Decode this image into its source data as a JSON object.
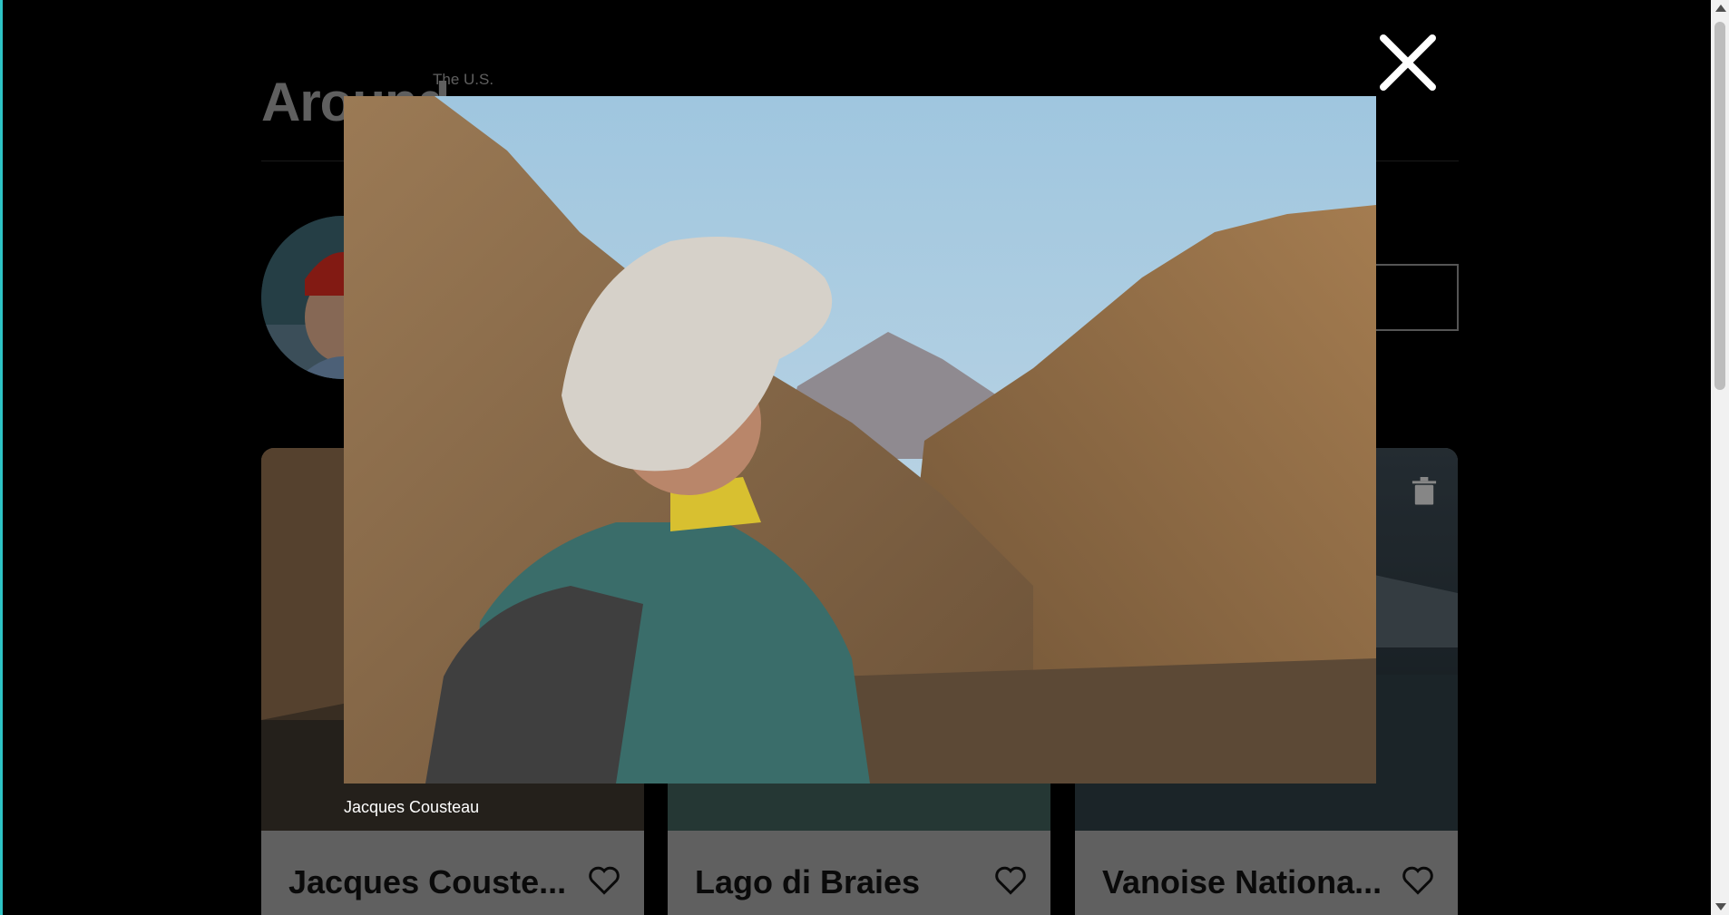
{
  "app": {
    "logo_main": "Around",
    "logo_sup": "The U.S."
  },
  "cards": [
    {
      "title": "Jacques Couste...",
      "liked": false
    },
    {
      "title": "Lago di Braies",
      "liked": false
    },
    {
      "title": "Vanoise Nationa...",
      "liked": false
    }
  ],
  "modal": {
    "caption": "Jacques Cousteau",
    "close_icon": "close-icon"
  },
  "icons": {
    "heart": "heart-outline-icon",
    "trash": "trash-icon"
  },
  "colors": {
    "accent": "#2ec4c6",
    "background": "#000000",
    "card_footer": "#9c9c9c"
  }
}
